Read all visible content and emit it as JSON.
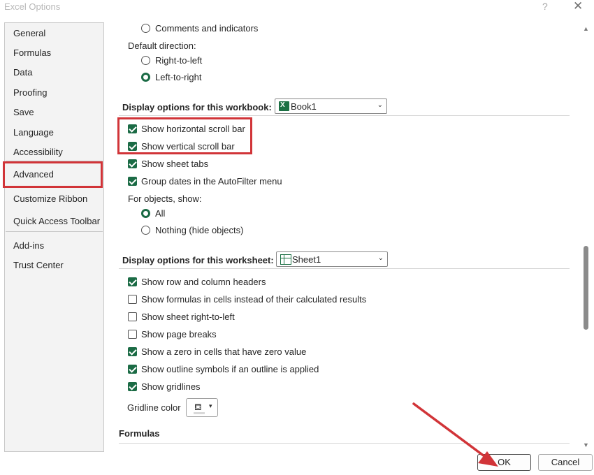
{
  "window": {
    "title": "Excel Options",
    "help": "?",
    "close": "✕"
  },
  "sidebar": {
    "items": [
      {
        "label": "General"
      },
      {
        "label": "Formulas"
      },
      {
        "label": "Data"
      },
      {
        "label": "Proofing"
      },
      {
        "label": "Save"
      },
      {
        "label": "Language"
      },
      {
        "label": "Accessibility"
      },
      {
        "label": "Advanced"
      },
      {
        "label": "Customize Ribbon"
      },
      {
        "label": "Quick Access Toolbar"
      },
      {
        "label": "Add-ins"
      },
      {
        "label": "Trust Center"
      }
    ]
  },
  "direction": {
    "comments_option": "Comments and indicators",
    "default_label": "Default direction:",
    "rtl": "Right-to-left",
    "ltr": "Left-to-right"
  },
  "workbook": {
    "heading": "Display options for this workbook:",
    "selected": "Book1",
    "horizontal_scroll": "Show horizontal scroll bar",
    "vertical_scroll": "Show vertical scroll bar",
    "sheet_tabs": "Show sheet tabs",
    "group_dates": "Group dates in the AutoFilter menu",
    "for_objects": "For objects, show:",
    "all": "All",
    "nothing": "Nothing (hide objects)"
  },
  "worksheet": {
    "heading": "Display options for this worksheet:",
    "selected": "Sheet1",
    "row_col_headers": "Show row and column headers",
    "formulas_in_cells": "Show formulas in cells instead of their calculated results",
    "sheet_rtl": "Show sheet right-to-left",
    "page_breaks": "Show page breaks",
    "zero_values": "Show a zero in cells that have zero value",
    "outline_symbols": "Show outline symbols if an outline is applied",
    "gridlines": "Show gridlines",
    "gridline_color": "Gridline color"
  },
  "formulas_heading": "Formulas",
  "buttons": {
    "ok": "OK",
    "cancel": "Cancel"
  },
  "colors": {
    "accent": "#1b6b45",
    "highlight": "#d13438"
  }
}
